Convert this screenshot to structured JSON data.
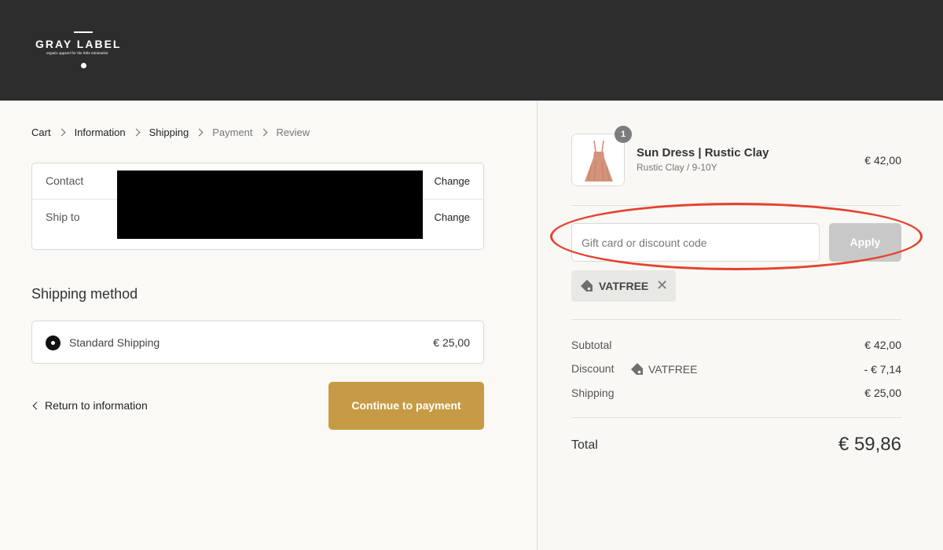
{
  "brand": {
    "name": "GRAY LABEL",
    "tagline": "organic apparel for the little minimalist"
  },
  "breadcrumb": [
    {
      "label": "Cart",
      "state": "completed"
    },
    {
      "label": "Information",
      "state": "completed"
    },
    {
      "label": "Shipping",
      "state": "current"
    },
    {
      "label": "Payment",
      "state": "upcoming"
    },
    {
      "label": "Review",
      "state": "upcoming"
    }
  ],
  "review": {
    "contact_label": "Contact",
    "ship_to_label": "Ship to",
    "change_label": "Change"
  },
  "shipping_method": {
    "title": "Shipping method",
    "option_name": "Standard Shipping",
    "option_price": "€ 25,00",
    "selected": true
  },
  "actions": {
    "back_label": "Return to information",
    "continue_label": "Continue to payment"
  },
  "order": {
    "item": {
      "quantity": "1",
      "name": "Sun Dress | Rustic Clay",
      "variant": "Rustic Clay / 9-10Y",
      "price": "€ 42,00"
    },
    "discount_field": {
      "placeholder": "Gift card or discount code",
      "apply_label": "Apply"
    },
    "applied_code": "VATFREE",
    "summary": {
      "subtotal_label": "Subtotal",
      "subtotal_value": "€ 42,00",
      "discount_label": "Discount",
      "discount_code": "VATFREE",
      "discount_value": "- € 7,14",
      "shipping_label": "Shipping",
      "shipping_value": "€ 25,00",
      "total_label": "Total",
      "total_value": "€ 59,86"
    }
  },
  "colors": {
    "header_bg": "#2d2d2d",
    "accent": "#c79b45",
    "annotation": "#e5412e",
    "dress": "#d4937a"
  }
}
